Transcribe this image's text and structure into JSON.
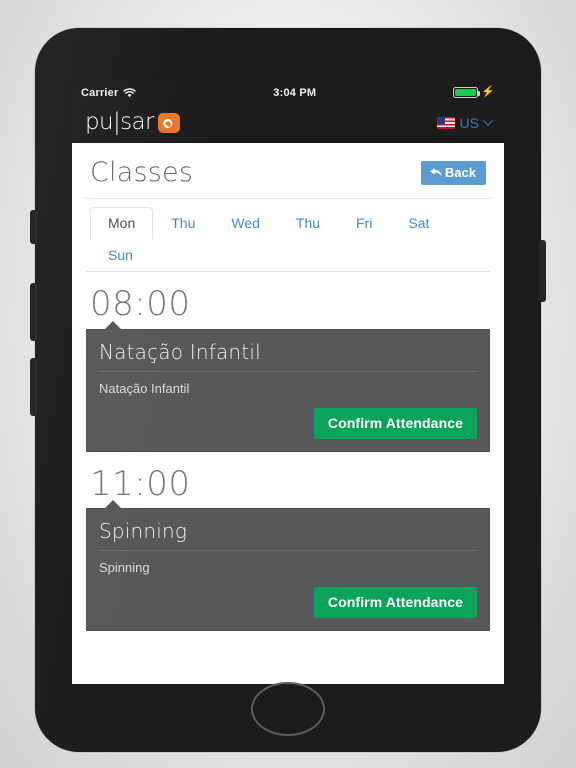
{
  "status_bar": {
    "carrier": "Carrier",
    "wifi_icon": "wifi-icon",
    "time": "3:04 PM",
    "battery_icon": "battery-full-icon",
    "charging_icon": "⚡"
  },
  "app_header": {
    "brand_text": "pu|sar",
    "brand_mark_icon": "pulsar-swoosh-icon",
    "brand_mark_color": "#e8772a",
    "locale": {
      "flag_icon": "us-flag-icon",
      "label": "US",
      "chevron_icon": "chevron-down-icon"
    }
  },
  "page": {
    "title": "Classes",
    "back_button": {
      "label": "Back",
      "icon": "back-arrow-icon",
      "color": "#5b9bd1"
    }
  },
  "tabs": [
    {
      "label": "Mon",
      "active": true
    },
    {
      "label": "Thu",
      "active": false
    },
    {
      "label": "Wed",
      "active": false
    },
    {
      "label": "Thu",
      "active": false
    },
    {
      "label": "Fri",
      "active": false
    },
    {
      "label": "Sat",
      "active": false
    },
    {
      "label": "Sun",
      "active": false
    }
  ],
  "slots": [
    {
      "time": "08:00",
      "class": {
        "title": "Natação Infantil",
        "description": "Natação Infantil",
        "action_label": "Confirm Attendance",
        "action_color": "#09a459"
      }
    },
    {
      "time": "11:00",
      "class": {
        "title": "Spinning",
        "description": "Spinning",
        "action_label": "Confirm Attendance",
        "action_color": "#09a459"
      }
    }
  ],
  "device": {
    "home_button_icon": "home-button",
    "side_buttons": [
      "silent-switch",
      "volume-up-button",
      "volume-down-button",
      "power-button"
    ]
  },
  "colors": {
    "card_background": "#58585a",
    "accent_green": "#09a459",
    "accent_blue": "#5b9bd1",
    "brand_orange": "#e8772a",
    "link_blue": "#3c8dc5"
  }
}
